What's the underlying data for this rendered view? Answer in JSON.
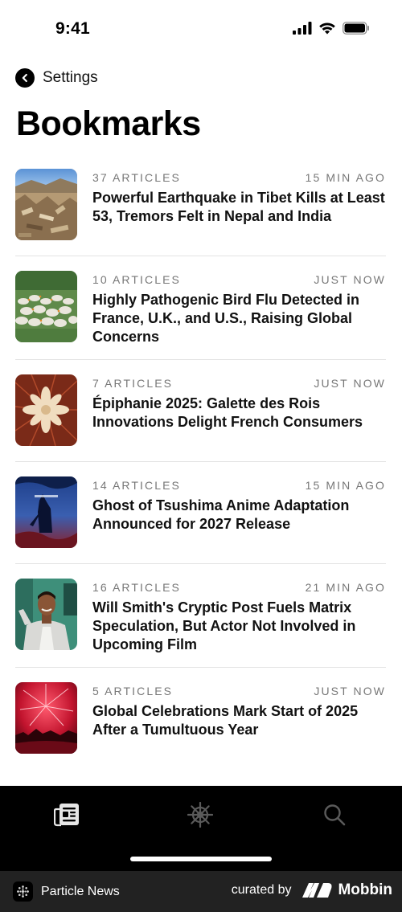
{
  "status_bar": {
    "time": "9:41"
  },
  "nav": {
    "back_label": "Settings"
  },
  "page": {
    "title": "Bookmarks"
  },
  "bookmarks": [
    {
      "articles": "37 ARTICLES",
      "time": "15 MIN AGO",
      "headline": "Powerful Earthquake in Tibet Kills at Least 53, Tremors Felt in Nepal and India",
      "thumb": "earthquake-rubble-image"
    },
    {
      "articles": "10 ARTICLES",
      "time": "JUST NOW",
      "headline": "Highly Pathogenic Bird Flu Detected in France, U.K., and U.S., Raising Global Concerns",
      "thumb": "geese-flock-image"
    },
    {
      "articles": "7 ARTICLES",
      "time": "JUST NOW",
      "headline": "Épiphanie 2025: Galette des Rois Innovations Delight French Consumers",
      "thumb": "galette-cake-image"
    },
    {
      "articles": "14 ARTICLES",
      "time": "15 MIN AGO",
      "headline": "Ghost of Tsushima Anime Adaptation Announced for 2027 Release",
      "thumb": "anime-poster-image"
    },
    {
      "articles": "16 ARTICLES",
      "time": "21 MIN AGO",
      "headline": "Will Smith's Cryptic Post Fuels Matrix Speculation, But Actor Not Involved in Upcoming Film",
      "thumb": "actor-portrait-image"
    },
    {
      "articles": "5 ARTICLES",
      "time": "JUST NOW",
      "headline": "Global Celebrations Mark Start of 2025 After a Tumultuous Year",
      "thumb": "fireworks-image"
    }
  ],
  "tab_bar": {
    "tabs": [
      {
        "icon": "newspaper-icon",
        "active": true
      },
      {
        "icon": "helm-icon",
        "active": false
      },
      {
        "icon": "search-icon",
        "active": false
      }
    ]
  },
  "footer": {
    "app_name": "Particle News",
    "curated_by": "curated by",
    "brand": "Mobbin"
  },
  "colors": {
    "tab_bar_bg": "#000000",
    "footer_bg": "#222222",
    "meta_text": "#777777"
  }
}
